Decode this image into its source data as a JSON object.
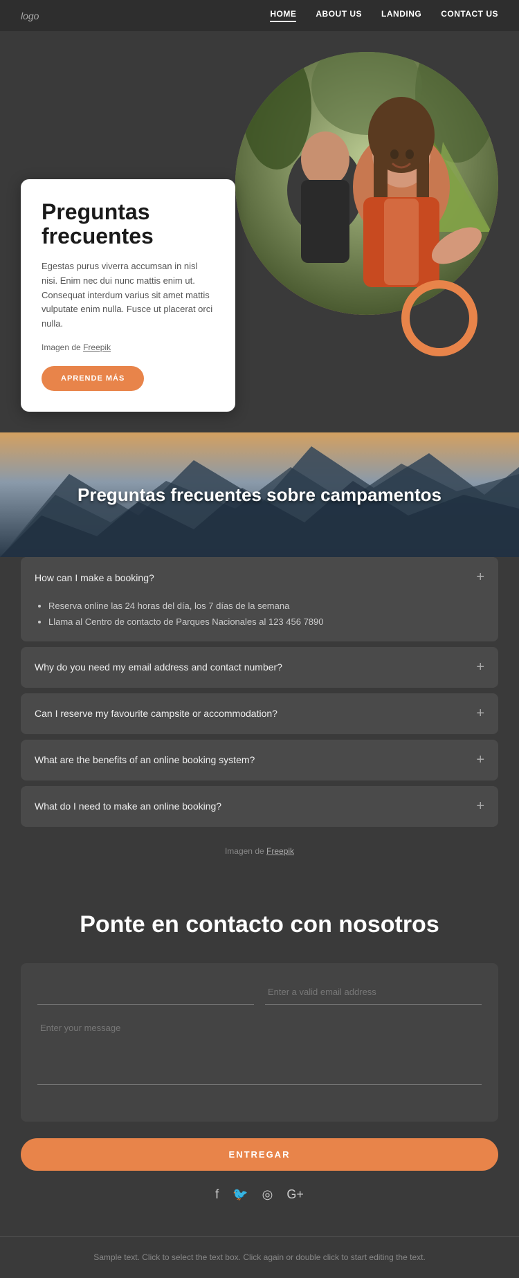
{
  "nav": {
    "logo": "logo",
    "links": [
      {
        "label": "HOME",
        "active": true
      },
      {
        "label": "ABOUT US",
        "active": false
      },
      {
        "label": "LANDING",
        "active": false
      },
      {
        "label": "CONTACT US",
        "active": false
      }
    ]
  },
  "hero": {
    "card_title": "Preguntas frecuentes",
    "card_text": "Egestas purus viverra accumsan in nisl nisi. Enim nec dui nunc mattis enim ut. Consequat interdum varius sit amet mattis vulputate enim nulla. Fusce ut placerat orci nulla.",
    "card_attribution_prefix": "Imagen de",
    "card_attribution_link": "Freepik",
    "btn_label": "APRENDE MÁS"
  },
  "faq_section": {
    "mountain_title": "Preguntas frecuentes sobre campamentos",
    "items": [
      {
        "question": "How can I make a booking?",
        "answer_items": [
          "Reserva online las 24 horas del día, los 7 días de la semana",
          "Llama al Centro de contacto de Parques Nacionales al 123 456 7890"
        ],
        "open": true
      },
      {
        "question": "Why do you need my email address and contact number?",
        "answer_items": [],
        "open": false
      },
      {
        "question": "Can I reserve my favourite campsite or accommodation?",
        "answer_items": [],
        "open": false
      },
      {
        "question": "What are the benefits of an online booking system?",
        "answer_items": [],
        "open": false
      },
      {
        "question": "What do I need to make an online booking?",
        "answer_items": [],
        "open": false
      }
    ],
    "attribution_prefix": "Imagen de",
    "attribution_link": "Freepik"
  },
  "contact": {
    "title": "Ponte en contacto con nosotros",
    "name_placeholder": "",
    "email_placeholder": "Enter a valid email address",
    "message_placeholder": "Enter your message",
    "submit_label": "ENTREGAR"
  },
  "social": {
    "icons": [
      "f",
      "𝕏",
      "◎",
      "G+"
    ]
  },
  "footer": {
    "text": "Sample text. Click to select the text box. Click again or double\nclick to start editing the text."
  }
}
